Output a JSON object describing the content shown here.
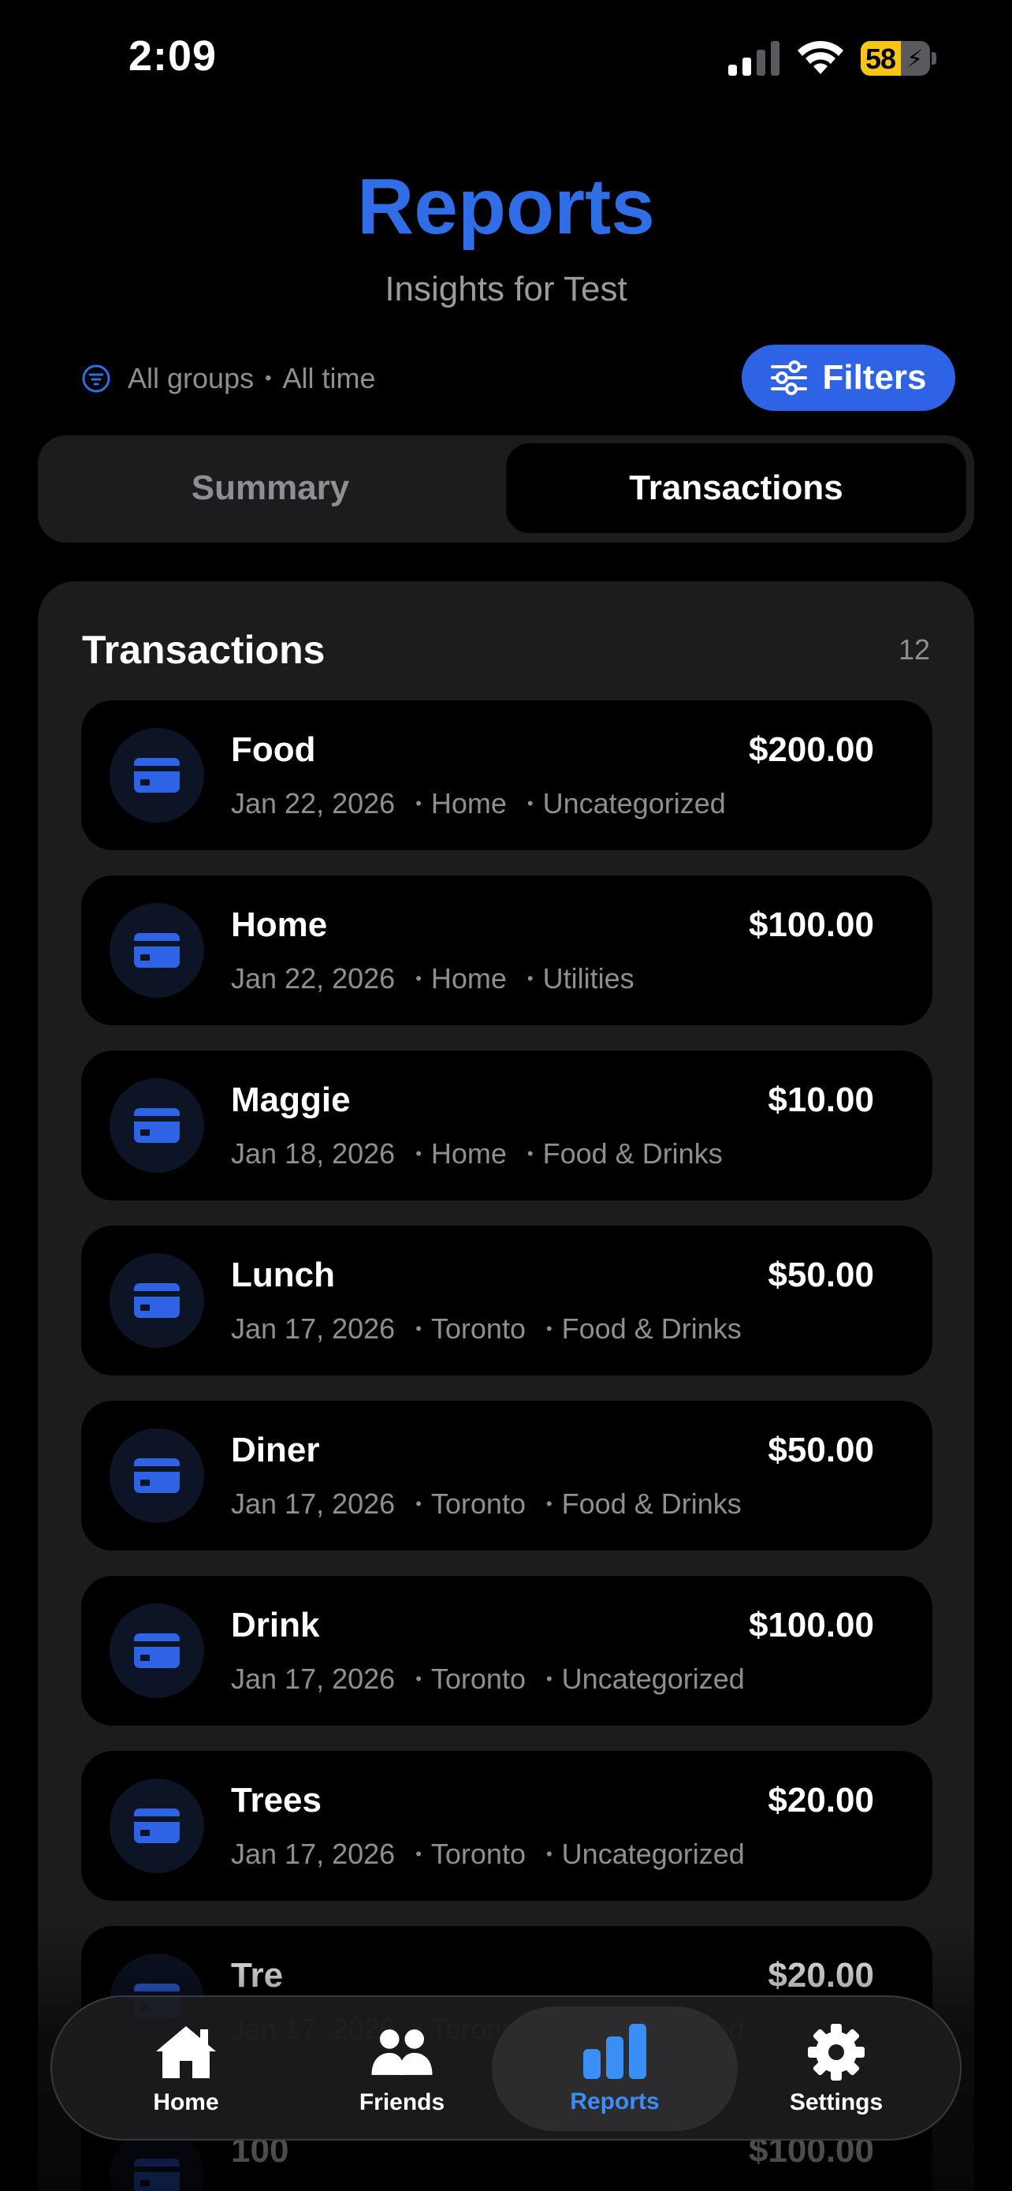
{
  "status": {
    "time": "2:09",
    "battery": "58",
    "battery_level": 0.58
  },
  "header": {
    "title": "Reports",
    "subtitle": "Insights for Test"
  },
  "filters": {
    "group": "All groups",
    "period": "All time",
    "button_label": "Filters"
  },
  "segments": {
    "summary": "Summary",
    "transactions": "Transactions",
    "selected": "Transactions"
  },
  "card": {
    "title": "Transactions",
    "count": "12"
  },
  "transactions": [
    {
      "name": "Food",
      "amount": "$200.00",
      "date": "Jan 22, 2026",
      "group": "Home",
      "category": "Uncategorized"
    },
    {
      "name": "Home",
      "amount": "$100.00",
      "date": "Jan 22, 2026",
      "group": "Home",
      "category": "Utilities"
    },
    {
      "name": "Maggie",
      "amount": "$10.00",
      "date": "Jan 18, 2026",
      "group": "Home",
      "category": "Food & Drinks"
    },
    {
      "name": "Lunch",
      "amount": "$50.00",
      "date": "Jan 17, 2026",
      "group": "Toronto",
      "category": "Food & Drinks"
    },
    {
      "name": "Diner",
      "amount": "$50.00",
      "date": "Jan 17, 2026",
      "group": "Toronto",
      "category": "Food & Drinks"
    },
    {
      "name": "Drink",
      "amount": "$100.00",
      "date": "Jan 17, 2026",
      "group": "Toronto",
      "category": "Uncategorized"
    },
    {
      "name": "Trees",
      "amount": "$20.00",
      "date": "Jan 17, 2026",
      "group": "Toronto",
      "category": "Uncategorized"
    },
    {
      "name": "Tre",
      "amount": "$20.00",
      "date": "Jan 17, 2026",
      "group": "Toronto",
      "category": "Uncategorized"
    },
    {
      "name": "100",
      "amount": "$100.00",
      "date": "",
      "group": "",
      "category": ""
    }
  ],
  "nav": {
    "home": "Home",
    "friends": "Friends",
    "reports": "Reports",
    "settings": "Settings",
    "active": "Reports"
  },
  "colors": {
    "accent": "#2f6ee6",
    "active_tab": "#3a8ef6",
    "battery": "#f5c518"
  }
}
